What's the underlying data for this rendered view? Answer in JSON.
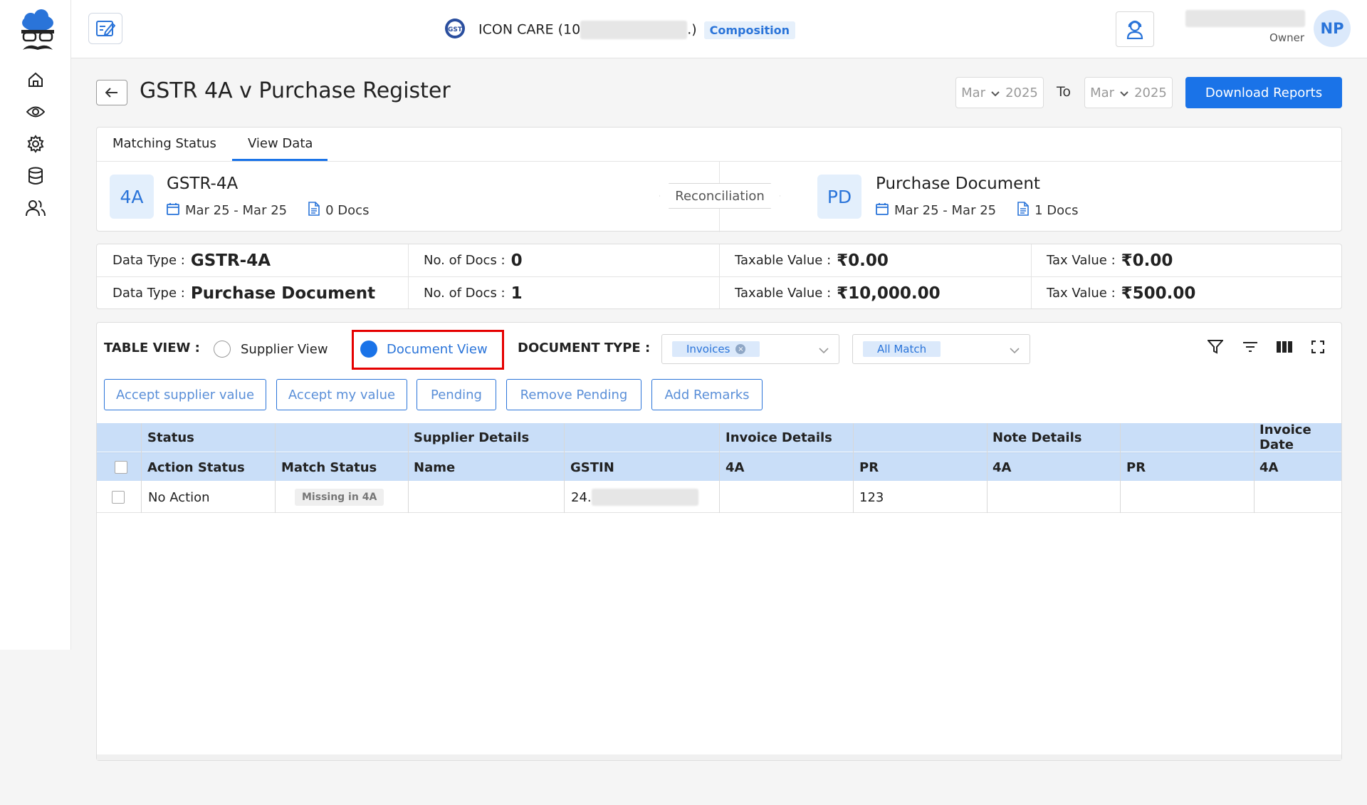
{
  "header": {
    "company_name_prefix": "ICON CARE (10",
    "company_name_suffix": ".)",
    "company_badge": "Composition",
    "user_role": "Owner",
    "user_initials": "NP"
  },
  "page": {
    "title": "GSTR 4A v Purchase Register",
    "from_month": "Mar",
    "from_year": "2025",
    "to_label": "To",
    "to_month": "Mar",
    "to_year": "2025",
    "download_label": "Download Reports"
  },
  "tabs": [
    {
      "label": "Matching Status",
      "active": false
    },
    {
      "label": "View Data",
      "active": true
    }
  ],
  "recon": {
    "left": {
      "badge": "4A",
      "title": "GSTR-4A",
      "period": "Mar 25 - Mar 25",
      "docs": "0 Docs"
    },
    "center_label": "Reconciliation",
    "right": {
      "badge": "PD",
      "title": "Purchase Document",
      "period": "Mar 25 - Mar 25",
      "docs": "1 Docs"
    }
  },
  "summary": {
    "rows": [
      {
        "data_type_label": "Data Type :",
        "data_type": "GSTR-4A",
        "docs_label": "No. of Docs :",
        "docs": "0",
        "taxable_label": "Taxable Value :",
        "taxable": "₹0.00",
        "tax_label": "Tax Value :",
        "tax": "₹0.00"
      },
      {
        "data_type_label": "Data Type :",
        "data_type": "Purchase Document",
        "docs_label": "No. of Docs :",
        "docs": "1",
        "taxable_label": "Taxable Value :",
        "taxable": "₹10,000.00",
        "tax_label": "Tax Value :",
        "tax": "₹500.00"
      }
    ]
  },
  "toolbar": {
    "table_view_label": "TABLE VIEW :",
    "supplier_view": "Supplier View",
    "document_view": "Document View",
    "selected_view": "Document View",
    "document_type_label": "DOCUMENT TYPE :",
    "document_type_value": "Invoices",
    "match_filter_value": "All Match",
    "actions": [
      "Accept supplier value",
      "Accept my value",
      "Pending",
      "Remove Pending",
      "Add Remarks"
    ]
  },
  "table": {
    "group_headers": [
      "Status",
      "Supplier Details",
      "Invoice Details",
      "Note Details",
      "Invoice Date"
    ],
    "sub_headers": [
      "Action Status",
      "Match Status",
      "Name",
      "GSTIN",
      "4A",
      "PR",
      "4A",
      "PR",
      "4A"
    ],
    "rows": [
      {
        "action_status": "No Action",
        "match_status": "Missing in 4A",
        "name": "",
        "gstin_prefix": "24.",
        "inv_4a": "",
        "inv_pr": "123",
        "note_4a": "",
        "note_pr": "",
        "date_4a": ""
      }
    ]
  },
  "colors": {
    "accent": "#1a73e8",
    "header_row": "#c9def8",
    "highlight": "#e50000"
  }
}
